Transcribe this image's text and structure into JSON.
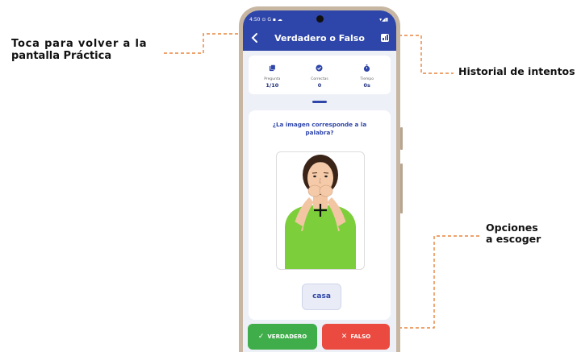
{
  "callouts": {
    "back_line1": "Toca para volver a la",
    "back_line2": "pantalla Práctica",
    "history": "Historial de intentos",
    "options_line1": "Opciones",
    "options_line2": "a escoger",
    "connector_color": "#e8843b"
  },
  "status_bar": {
    "time": "4:50",
    "icons": "⊙ G ▪ ☁",
    "right_icons": "▾◢▮"
  },
  "header": {
    "title": "Verdadero o Falso",
    "back_icon": "chevron-left-icon",
    "history_icon": "bar-chart-icon"
  },
  "stats": [
    {
      "icon": "cards-icon",
      "label": "Pregunta",
      "value": "1/10"
    },
    {
      "icon": "check-circle-icon",
      "label": "Correctas",
      "value": "0"
    },
    {
      "icon": "stopwatch-icon",
      "label": "Tiempo",
      "value": "0s"
    }
  ],
  "quiz": {
    "question": "¿La imagen corresponde a la palabra?",
    "image": "sign-language-illustration",
    "word": "casa"
  },
  "answers": {
    "true_label": "VERDADERO",
    "false_label": "FALSO"
  },
  "colors": {
    "primary": "#2e45a9",
    "true": "#3fae4a",
    "false": "#ea4a3f",
    "background": "#eef0f7"
  }
}
